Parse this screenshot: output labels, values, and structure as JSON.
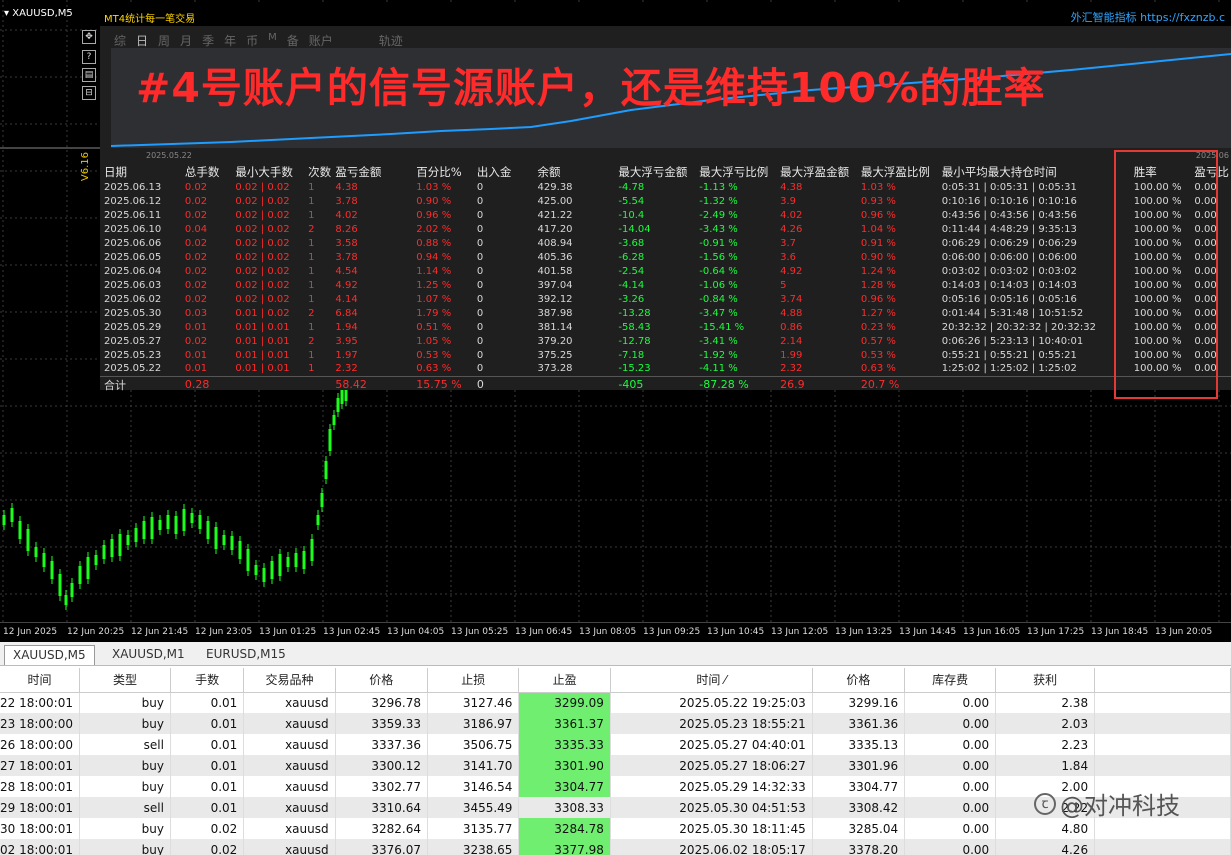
{
  "chart": {
    "symbol": "XAUUSD,M5",
    "vertical_label": "V6.16",
    "toolbar_icons": [
      "move-icon",
      "help-icon",
      "settings-icon",
      "restore-icon"
    ],
    "toolbar_glyphs": [
      "✥",
      "?",
      "▤",
      "⊟"
    ]
  },
  "panel": {
    "title": "MT4统计每一笔交易",
    "brand": "外汇智能指标 https://fxznzb.c",
    "period_tabs": [
      "综",
      "日",
      "周",
      "月",
      "季",
      "年",
      "币",
      "M",
      "备",
      "账户",
      "轨迹"
    ],
    "active_tab": "日",
    "headline": "#4号账户的信号源账户，还是维持100%的胜率",
    "date_start": "2025.05.22",
    "date_end": "2025.06"
  },
  "stats": {
    "headers": [
      "日期",
      "总手数",
      "最小大手数",
      "次数",
      "盈亏金额",
      "百分比%",
      "出入金",
      "余额",
      "最大浮亏金额",
      "最大浮亏比例",
      "最大浮盈金额",
      "最大浮盈比例",
      "最小平均最大持仓时间",
      "",
      "胜率",
      "盈亏比"
    ],
    "rows": [
      [
        "2025.06.13",
        "0.02",
        "0.02 | 0.02",
        "1",
        "4.38",
        "1.03 %",
        "0",
        "429.38",
        "-4.78",
        "-1.13 %",
        "4.38",
        "1.03 %",
        "0:05:31 | 0:05:31 | 0:05:31",
        "",
        "100.00 %",
        "0.00"
      ],
      [
        "2025.06.12",
        "0.02",
        "0.02 | 0.02",
        "1",
        "3.78",
        "0.90 %",
        "0",
        "425.00",
        "-5.54",
        "-1.32 %",
        "3.9",
        "0.93 %",
        "0:10:16 | 0:10:16 | 0:10:16",
        "",
        "100.00 %",
        "0.00"
      ],
      [
        "2025.06.11",
        "0.02",
        "0.02 | 0.02",
        "1",
        "4.02",
        "0.96 %",
        "0",
        "421.22",
        "-10.4",
        "-2.49 %",
        "4.02",
        "0.96 %",
        "0:43:56 | 0:43:56 | 0:43:56",
        "",
        "100.00 %",
        "0.00"
      ],
      [
        "2025.06.10",
        "0.04",
        "0.02 | 0.02",
        "2",
        "8.26",
        "2.02 %",
        "0",
        "417.20",
        "-14.04",
        "-3.43 %",
        "4.26",
        "1.04 %",
        "0:11:44 | 4:48:29 | 9:35:13",
        "",
        "100.00 %",
        "0.00"
      ],
      [
        "2025.06.06",
        "0.02",
        "0.02 | 0.02",
        "1",
        "3.58",
        "0.88 %",
        "0",
        "408.94",
        "-3.68",
        "-0.91 %",
        "3.7",
        "0.91 %",
        "0:06:29 | 0:06:29 | 0:06:29",
        "",
        "100.00 %",
        "0.00"
      ],
      [
        "2025.06.05",
        "0.02",
        "0.02 | 0.02",
        "1",
        "3.78",
        "0.94 %",
        "0",
        "405.36",
        "-6.28",
        "-1.56 %",
        "3.6",
        "0.90 %",
        "0:06:00 | 0:06:00 | 0:06:00",
        "",
        "100.00 %",
        "0.00"
      ],
      [
        "2025.06.04",
        "0.02",
        "0.02 | 0.02",
        "1",
        "4.54",
        "1.14 %",
        "0",
        "401.58",
        "-2.54",
        "-0.64 %",
        "4.92",
        "1.24 %",
        "0:03:02 | 0:03:02 | 0:03:02",
        "",
        "100.00 %",
        "0.00"
      ],
      [
        "2025.06.03",
        "0.02",
        "0.02 | 0.02",
        "1",
        "4.92",
        "1.25 %",
        "0",
        "397.04",
        "-4.14",
        "-1.06 %",
        "5",
        "1.28 %",
        "0:14:03 | 0:14:03 | 0:14:03",
        "",
        "100.00 %",
        "0.00"
      ],
      [
        "2025.06.02",
        "0.02",
        "0.02 | 0.02",
        "1",
        "4.14",
        "1.07 %",
        "0",
        "392.12",
        "-3.26",
        "-0.84 %",
        "3.74",
        "0.96 %",
        "0:05:16 | 0:05:16 | 0:05:16",
        "",
        "100.00 %",
        "0.00"
      ],
      [
        "2025.05.30",
        "0.03",
        "0.01 | 0.02",
        "2",
        "6.84",
        "1.79 %",
        "0",
        "387.98",
        "-13.28",
        "-3.47 %",
        "4.88",
        "1.27 %",
        "0:01:44 | 5:31:48 | 10:51:52",
        "",
        "100.00 %",
        "0.00"
      ],
      [
        "2025.05.29",
        "0.01",
        "0.01 | 0.01",
        "1",
        "1.94",
        "0.51 %",
        "0",
        "381.14",
        "-58.43",
        "-15.41 %",
        "0.86",
        "0.23 %",
        "20:32:32 | 20:32:32 | 20:32:32",
        "",
        "100.00 %",
        "0.00"
      ],
      [
        "2025.05.27",
        "0.02",
        "0.01 | 0.01",
        "2",
        "3.95",
        "1.05 %",
        "0",
        "379.20",
        "-12.78",
        "-3.41 %",
        "2.14",
        "0.57 %",
        "0:06:26 | 5:23:13 | 10:40:01",
        "",
        "100.00 %",
        "0.00"
      ],
      [
        "2025.05.23",
        "0.01",
        "0.01 | 0.01",
        "1",
        "1.97",
        "0.53 %",
        "0",
        "375.25",
        "-7.18",
        "-1.92 %",
        "1.99",
        "0.53 %",
        "0:55:21 | 0:55:21 | 0:55:21",
        "",
        "100.00 %",
        "0.00"
      ],
      [
        "2025.05.22",
        "0.01",
        "0.01 | 0.01",
        "1",
        "2.32",
        "0.63 %",
        "0",
        "373.28",
        "-15.23",
        "-4.11 %",
        "2.32",
        "0.63 %",
        "1:25:02 | 1:25:02 | 1:25:02",
        "",
        "100.00 %",
        "0.00"
      ]
    ],
    "total": [
      "合计",
      "0.28",
      "",
      "",
      "58.42",
      "15.75 %",
      "0",
      "",
      "-405",
      "-87.28 %",
      "26.9",
      "20.7 %",
      "",
      "",
      "",
      ""
    ]
  },
  "time_axis": [
    "12 Jun 2025",
    "12 Jun 20:25",
    "12 Jun 21:45",
    "12 Jun 23:05",
    "13 Jun 01:25",
    "13 Jun 02:45",
    "13 Jun 04:05",
    "13 Jun 05:25",
    "13 Jun 06:45",
    "13 Jun 08:05",
    "13 Jun 09:25",
    "13 Jun 10:45",
    "13 Jun 12:05",
    "13 Jun 13:25",
    "13 Jun 14:45",
    "13 Jun 16:05",
    "13 Jun 17:25",
    "13 Jun 18:45",
    "13 Jun 20:05"
  ],
  "chart_tabs": [
    "XAUUSD,M5",
    "XAUUSD,M1",
    "EURUSD,M15"
  ],
  "trades": {
    "headers": [
      "时间",
      "类型",
      "手数",
      "交易品种",
      "价格",
      "止损",
      "止盈",
      "时间  ⁄",
      "价格",
      "库存费",
      "获利"
    ],
    "rows": [
      [
        "22 18:00:01",
        "buy",
        "0.01",
        "xauusd",
        "3296.78",
        "3127.46",
        "3299.09",
        "2025.05.22 19:25:03",
        "3299.16",
        "0.00",
        "2.38"
      ],
      [
        "23 18:00:00",
        "buy",
        "0.01",
        "xauusd",
        "3359.33",
        "3186.97",
        "3361.37",
        "2025.05.23 18:55:21",
        "3361.36",
        "0.00",
        "2.03"
      ],
      [
        "26 18:00:00",
        "sell",
        "0.01",
        "xauusd",
        "3337.36",
        "3506.75",
        "3335.33",
        "2025.05.27 04:40:01",
        "3335.13",
        "0.00",
        "2.23"
      ],
      [
        "27 18:00:01",
        "buy",
        "0.01",
        "xauusd",
        "3300.12",
        "3141.70",
        "3301.90",
        "2025.05.27 18:06:27",
        "3301.96",
        "0.00",
        "1.84"
      ],
      [
        "28 18:00:01",
        "buy",
        "0.01",
        "xauusd",
        "3302.77",
        "3146.54",
        "3304.77",
        "2025.05.29 14:32:33",
        "3304.77",
        "0.00",
        "2.00"
      ],
      [
        "29 18:00:01",
        "sell",
        "0.01",
        "xauusd",
        "3310.64",
        "3455.49",
        "3308.33",
        "2025.05.30 04:51:53",
        "3308.42",
        "0.00",
        "2.22"
      ],
      [
        "30 18:00:01",
        "buy",
        "0.02",
        "xauusd",
        "3282.64",
        "3135.77",
        "3284.78",
        "2025.05.30 18:11:45",
        "3285.04",
        "0.00",
        "4.80"
      ],
      [
        "02 18:00:01",
        "buy",
        "0.02",
        "xauusd",
        "3376.07",
        "3238.65",
        "3377.98",
        "2025.06.02 18:05:17",
        "3378.20",
        "0.00",
        "4.26"
      ]
    ],
    "tp_highlight_rows": [
      0,
      1,
      2,
      3,
      4,
      6,
      7
    ]
  },
  "watermark": "@对冲科技"
}
